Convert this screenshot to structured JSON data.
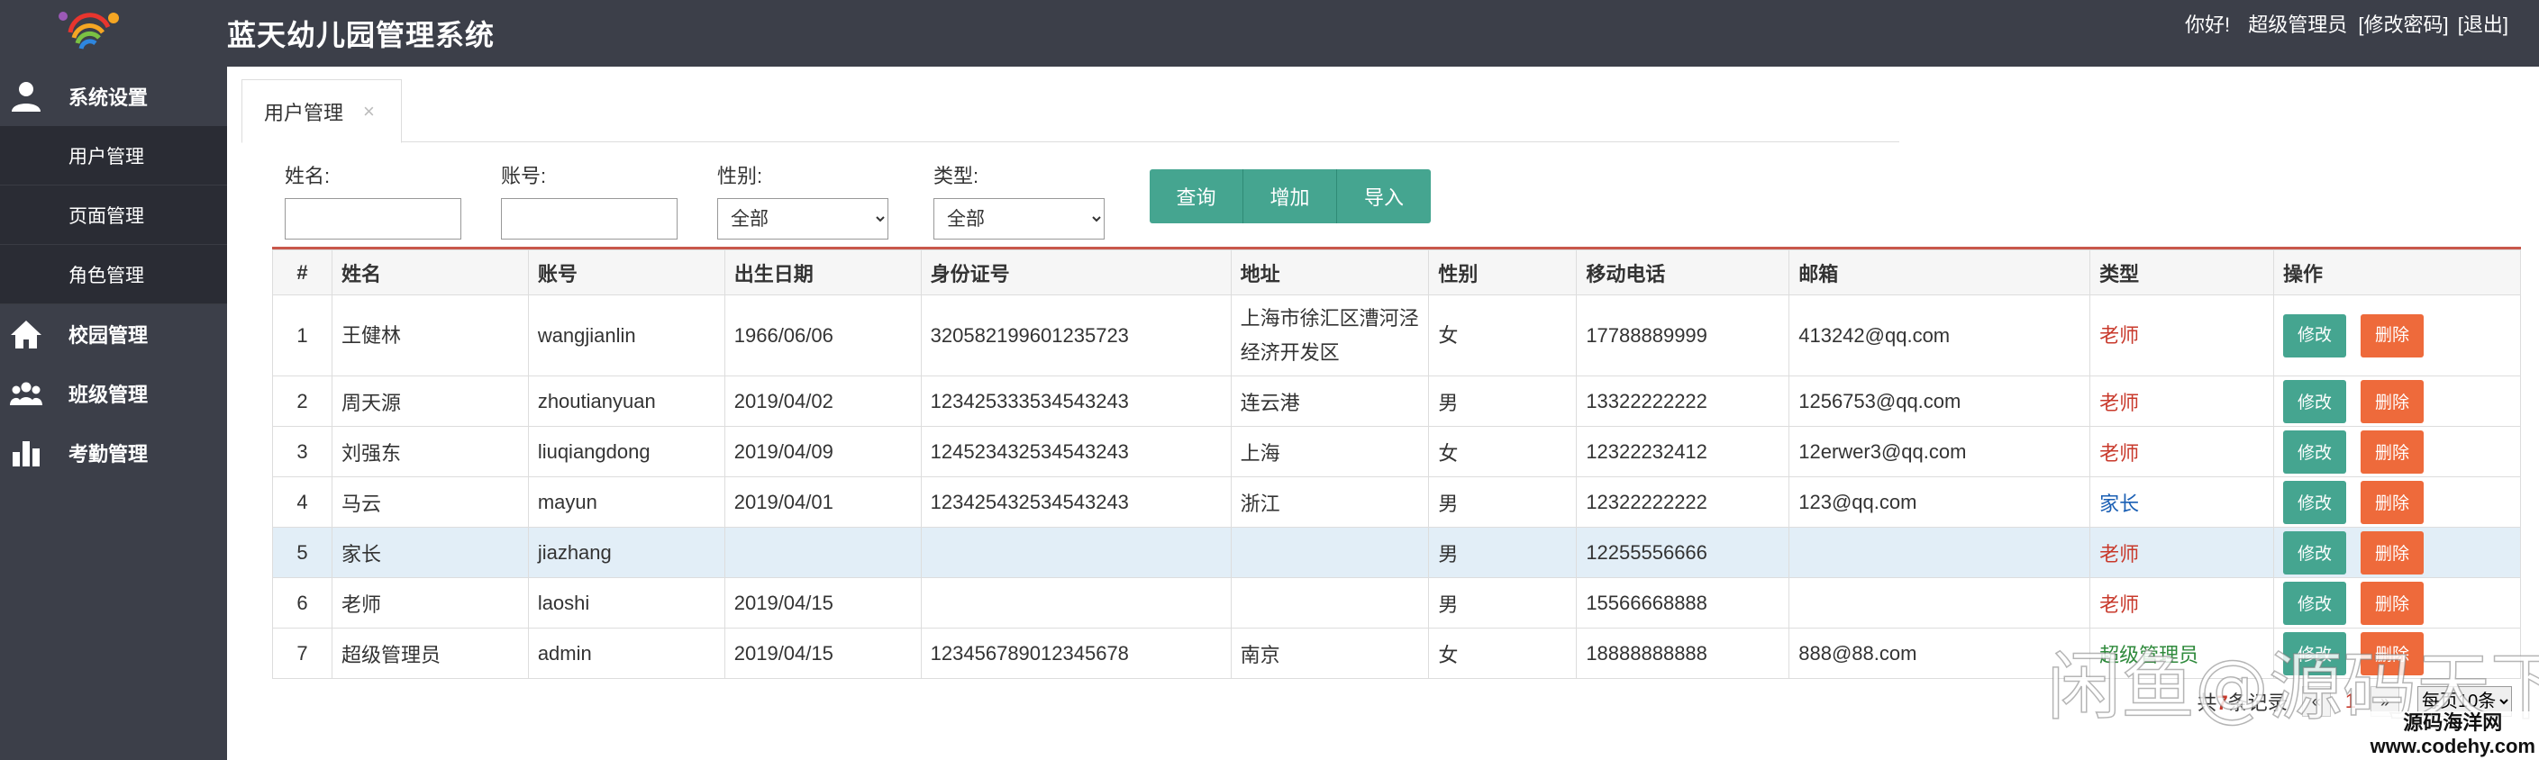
{
  "app": {
    "title": "蓝天幼儿园管理系统"
  },
  "user_bar": {
    "greeting": "你好!",
    "role": "超级管理员",
    "change_password": "[修改密码]",
    "logout": "[退出]"
  },
  "sidebar": {
    "groups": [
      {
        "label": "系统设置",
        "icon": "user-icon",
        "items": [
          {
            "label": "用户管理"
          },
          {
            "label": "页面管理"
          },
          {
            "label": "角色管理"
          }
        ]
      },
      {
        "label": "校园管理",
        "icon": "home-icon"
      },
      {
        "label": "班级管理",
        "icon": "group-icon"
      },
      {
        "label": "考勤管理",
        "icon": "bar-chart-icon"
      }
    ]
  },
  "tabs": [
    {
      "label": "用户管理",
      "close": "×"
    }
  ],
  "search": {
    "name_label": "姓名:",
    "name_value": "",
    "account_label": "账号:",
    "account_value": "",
    "gender_label": "性别:",
    "gender_selected": "全部",
    "type_label": "类型:",
    "type_selected": "全部",
    "query_button": "查询",
    "add_button": "增加",
    "import_button": "导入"
  },
  "table": {
    "headers": [
      "#",
      "姓名",
      "账号",
      "出生日期",
      "身份证号",
      "地址",
      "性别",
      "移动电话",
      "邮箱",
      "类型",
      "操作"
    ],
    "edit_label": "修改",
    "delete_label": "删除",
    "rows": [
      {
        "num": "1",
        "name": "王健林",
        "account": "wangjianlin",
        "birth": "1966/06/06",
        "id_card": "320582199601235723",
        "address": "上海市徐汇区漕河泾经济开发区",
        "gender": "女",
        "phone": "17788889999",
        "email": "413242@qq.com",
        "type": "老师"
      },
      {
        "num": "2",
        "name": "周天源",
        "account": "zhoutianyuan",
        "birth": "2019/04/02",
        "id_card": "123425333534543243",
        "address": "连云港",
        "gender": "男",
        "phone": "13322222222",
        "email": "1256753@qq.com",
        "type": "老师"
      },
      {
        "num": "3",
        "name": "刘强东",
        "account": "liuqiangdong",
        "birth": "2019/04/09",
        "id_card": "124523432534543243",
        "address": "上海",
        "gender": "女",
        "phone": "12322232412",
        "email": "12erwer3@qq.com",
        "type": "老师"
      },
      {
        "num": "4",
        "name": "马云",
        "account": "mayun",
        "birth": "2019/04/01",
        "id_card": "123425432534543243",
        "address": "浙江",
        "gender": "男",
        "phone": "12322222222",
        "email": "123@qq.com",
        "type": "家长"
      },
      {
        "num": "5",
        "name": "家长",
        "account": "jiazhang",
        "birth": "",
        "id_card": "",
        "address": "",
        "gender": "男",
        "phone": "12255556666",
        "email": "",
        "type": "老师"
      },
      {
        "num": "6",
        "name": "老师",
        "account": "laoshi",
        "birth": "2019/04/15",
        "id_card": "",
        "address": "",
        "gender": "男",
        "phone": "15566668888",
        "email": "",
        "type": "老师"
      },
      {
        "num": "7",
        "name": "超级管理员",
        "account": "admin",
        "birth": "2019/04/15",
        "id_card": "123456789012345678",
        "address": "南京",
        "gender": "女",
        "phone": "18888888888",
        "email": "888@88.com",
        "type": "超级管理员"
      }
    ]
  },
  "pager": {
    "total_prefix": "共",
    "total_count": "7",
    "total_suffix": "条记录",
    "prev": "«",
    "current": "1",
    "next": "»",
    "page_size": "每页10条"
  },
  "watermark": {
    "text": "闲鱼@源码天下",
    "site_name": "源码海洋网",
    "site_url": "www.codehy.com"
  },
  "colors": {
    "header_bg": "#3c3f49",
    "accent_green": "#45a590",
    "delete_orange": "#ee6a3b",
    "teacher_red": "#c8392b",
    "parent_blue": "#1a5fb4"
  }
}
